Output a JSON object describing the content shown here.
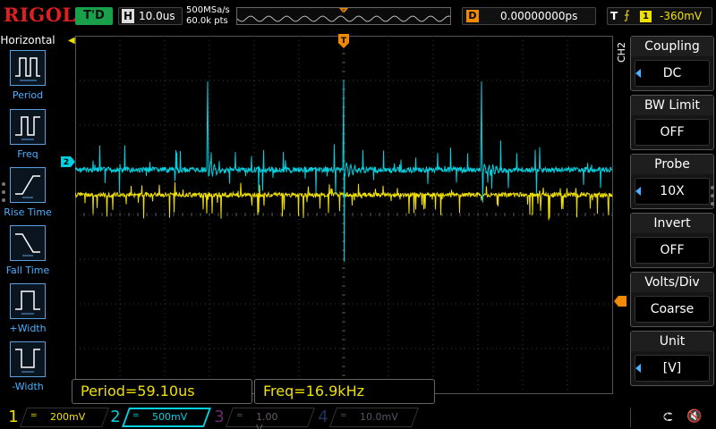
{
  "header": {
    "brand": "RIGOL",
    "trigger_status": "T'D",
    "timebase_letter": "H",
    "timebase": "10.0us",
    "sample_rate": "500MSa/s",
    "memory_depth": "60.0k pts",
    "overview_trigger_marker": "T",
    "delay_letter": "D",
    "delay": "0.00000000ps",
    "trigger_letter": "T",
    "trigger_source": "1",
    "trigger_level": "-360mV"
  },
  "left_panel": {
    "title": "Horizontal",
    "items": [
      {
        "label": "Period",
        "icon": "period-icon"
      },
      {
        "label": "Freq",
        "icon": "frequency-icon"
      },
      {
        "label": "Rise Time",
        "icon": "rise-time-icon"
      },
      {
        "label": "Fall Time",
        "icon": "fall-time-icon"
      },
      {
        "label": "+Width",
        "icon": "positive-width-icon"
      },
      {
        "label": "-Width",
        "icon": "negative-width-icon"
      }
    ]
  },
  "markers": {
    "trigger_position": "T",
    "channel2": "2"
  },
  "right_menu": {
    "channel_tag": "CH2",
    "items": [
      {
        "title": "Coupling",
        "value": "DC",
        "arrow": true
      },
      {
        "title": "BW Limit",
        "value": "OFF",
        "arrow": false
      },
      {
        "title": "Probe",
        "value": "10X",
        "arrow": true
      },
      {
        "title": "Invert",
        "value": "OFF",
        "arrow": false
      },
      {
        "title": "Volts/Div",
        "value": "Coarse",
        "arrow": false
      },
      {
        "title": "Unit",
        "value": "[V]",
        "arrow": true
      }
    ]
  },
  "measurements": {
    "period": "Period=59.10us",
    "freq": "Freq=16.9kHz"
  },
  "channels": [
    {
      "num": "1",
      "coupling": "=",
      "scale": "200mV"
    },
    {
      "num": "2",
      "coupling": "=",
      "scale": "500mV"
    },
    {
      "num": "3",
      "coupling": "=",
      "scale": "1.00 V"
    },
    {
      "num": "4",
      "coupling": "=",
      "scale": "10.0mV"
    }
  ],
  "status_icons": {
    "usb": "usb-icon",
    "sound": "speaker-muted-icon"
  },
  "colors": {
    "ch1": "#f0e000",
    "ch2": "#00d0e0",
    "menu_accent": "#4ab0ff",
    "trigger_orange": "#f08a00",
    "brand_red": "#e02020"
  }
}
